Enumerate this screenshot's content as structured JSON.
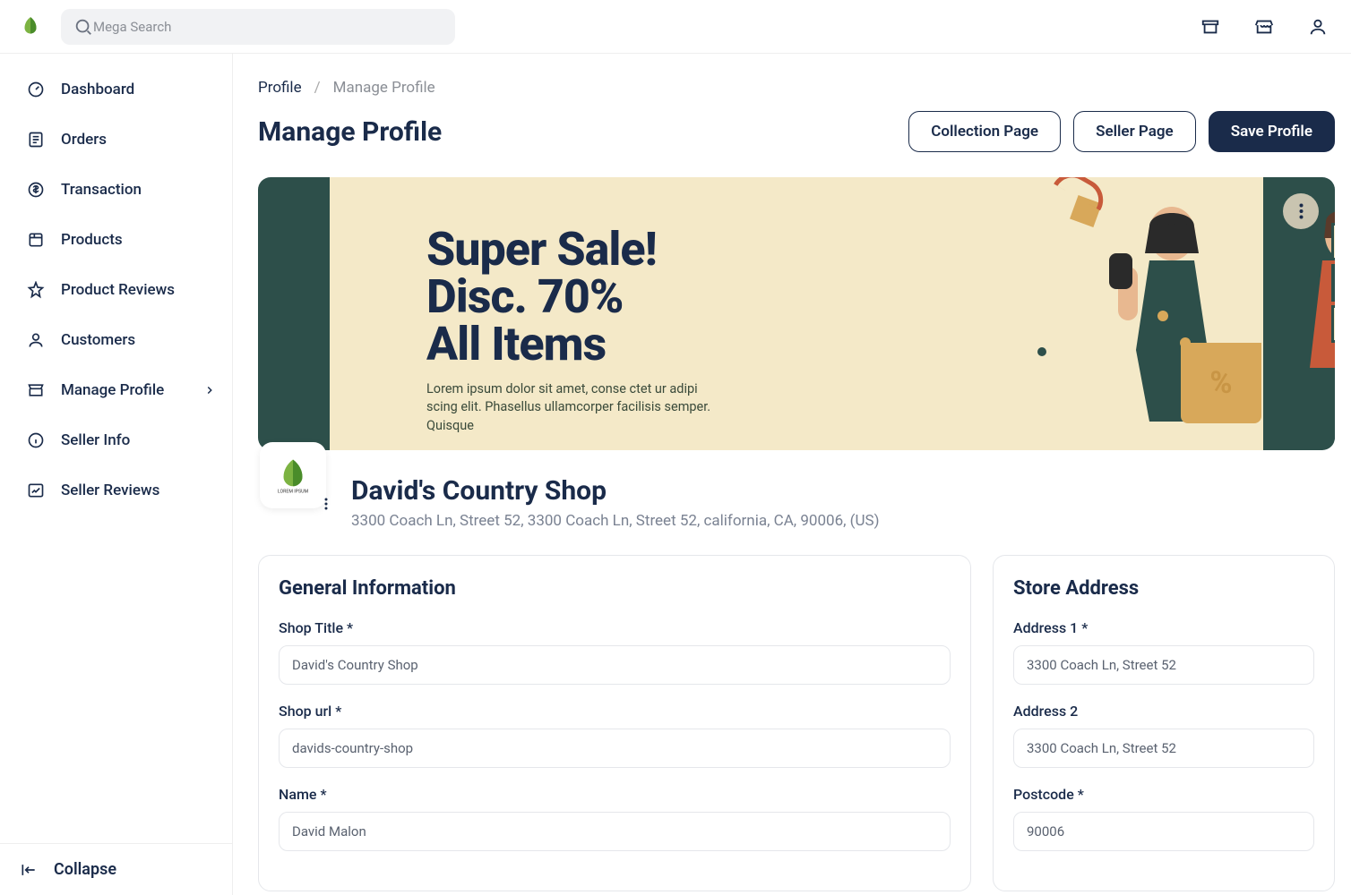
{
  "header": {
    "search_placeholder": "Mega Search"
  },
  "sidebar": {
    "items": [
      {
        "label": "Dashboard"
      },
      {
        "label": "Orders"
      },
      {
        "label": "Transaction"
      },
      {
        "label": "Products"
      },
      {
        "label": "Product Reviews"
      },
      {
        "label": "Customers"
      },
      {
        "label": "Manage Profile"
      },
      {
        "label": "Seller Info"
      },
      {
        "label": "Seller Reviews"
      }
    ],
    "collapse_label": "Collapse"
  },
  "breadcrumb": {
    "root": "Profile",
    "sep": "/",
    "current": "Manage Profile"
  },
  "page": {
    "title": "Manage Profile",
    "btn_collection": "Collection Page",
    "btn_seller": "Seller Page",
    "btn_save": "Save Profile"
  },
  "banner": {
    "line1": "Super Sale!",
    "line2": "Disc. 70%",
    "line3": "All Items",
    "sub": "Lorem ipsum dolor sit amet, conse ctet ur adipi scing elit. Phasellus ullamcorper facilisis semper. Quisque"
  },
  "shop": {
    "name": "David's Country Shop",
    "address": "3300 Coach Ln, Street 52, 3300 Coach Ln, Street 52, california, CA, 90006, (US)"
  },
  "general": {
    "heading": "General Information",
    "shop_title_label": "Shop Title *",
    "shop_title": "David's Country Shop",
    "shop_url_label": "Shop url *",
    "shop_url": "davids-country-shop",
    "name_label": "Name *",
    "name": "David Malon"
  },
  "store": {
    "heading": "Store Address",
    "addr1_label": "Address 1 *",
    "addr1": "3300 Coach Ln, Street 52",
    "addr2_label": "Address 2",
    "addr2": "3300 Coach Ln, Street 52",
    "postcode_label": "Postcode *",
    "postcode": "90006"
  },
  "colors": {
    "primary": "#1a2b4a",
    "banner_bg": "#2d4f4a",
    "banner_inner": "#f4e9c8",
    "accent": "#d8a85a",
    "orange": "#c85a3a"
  }
}
